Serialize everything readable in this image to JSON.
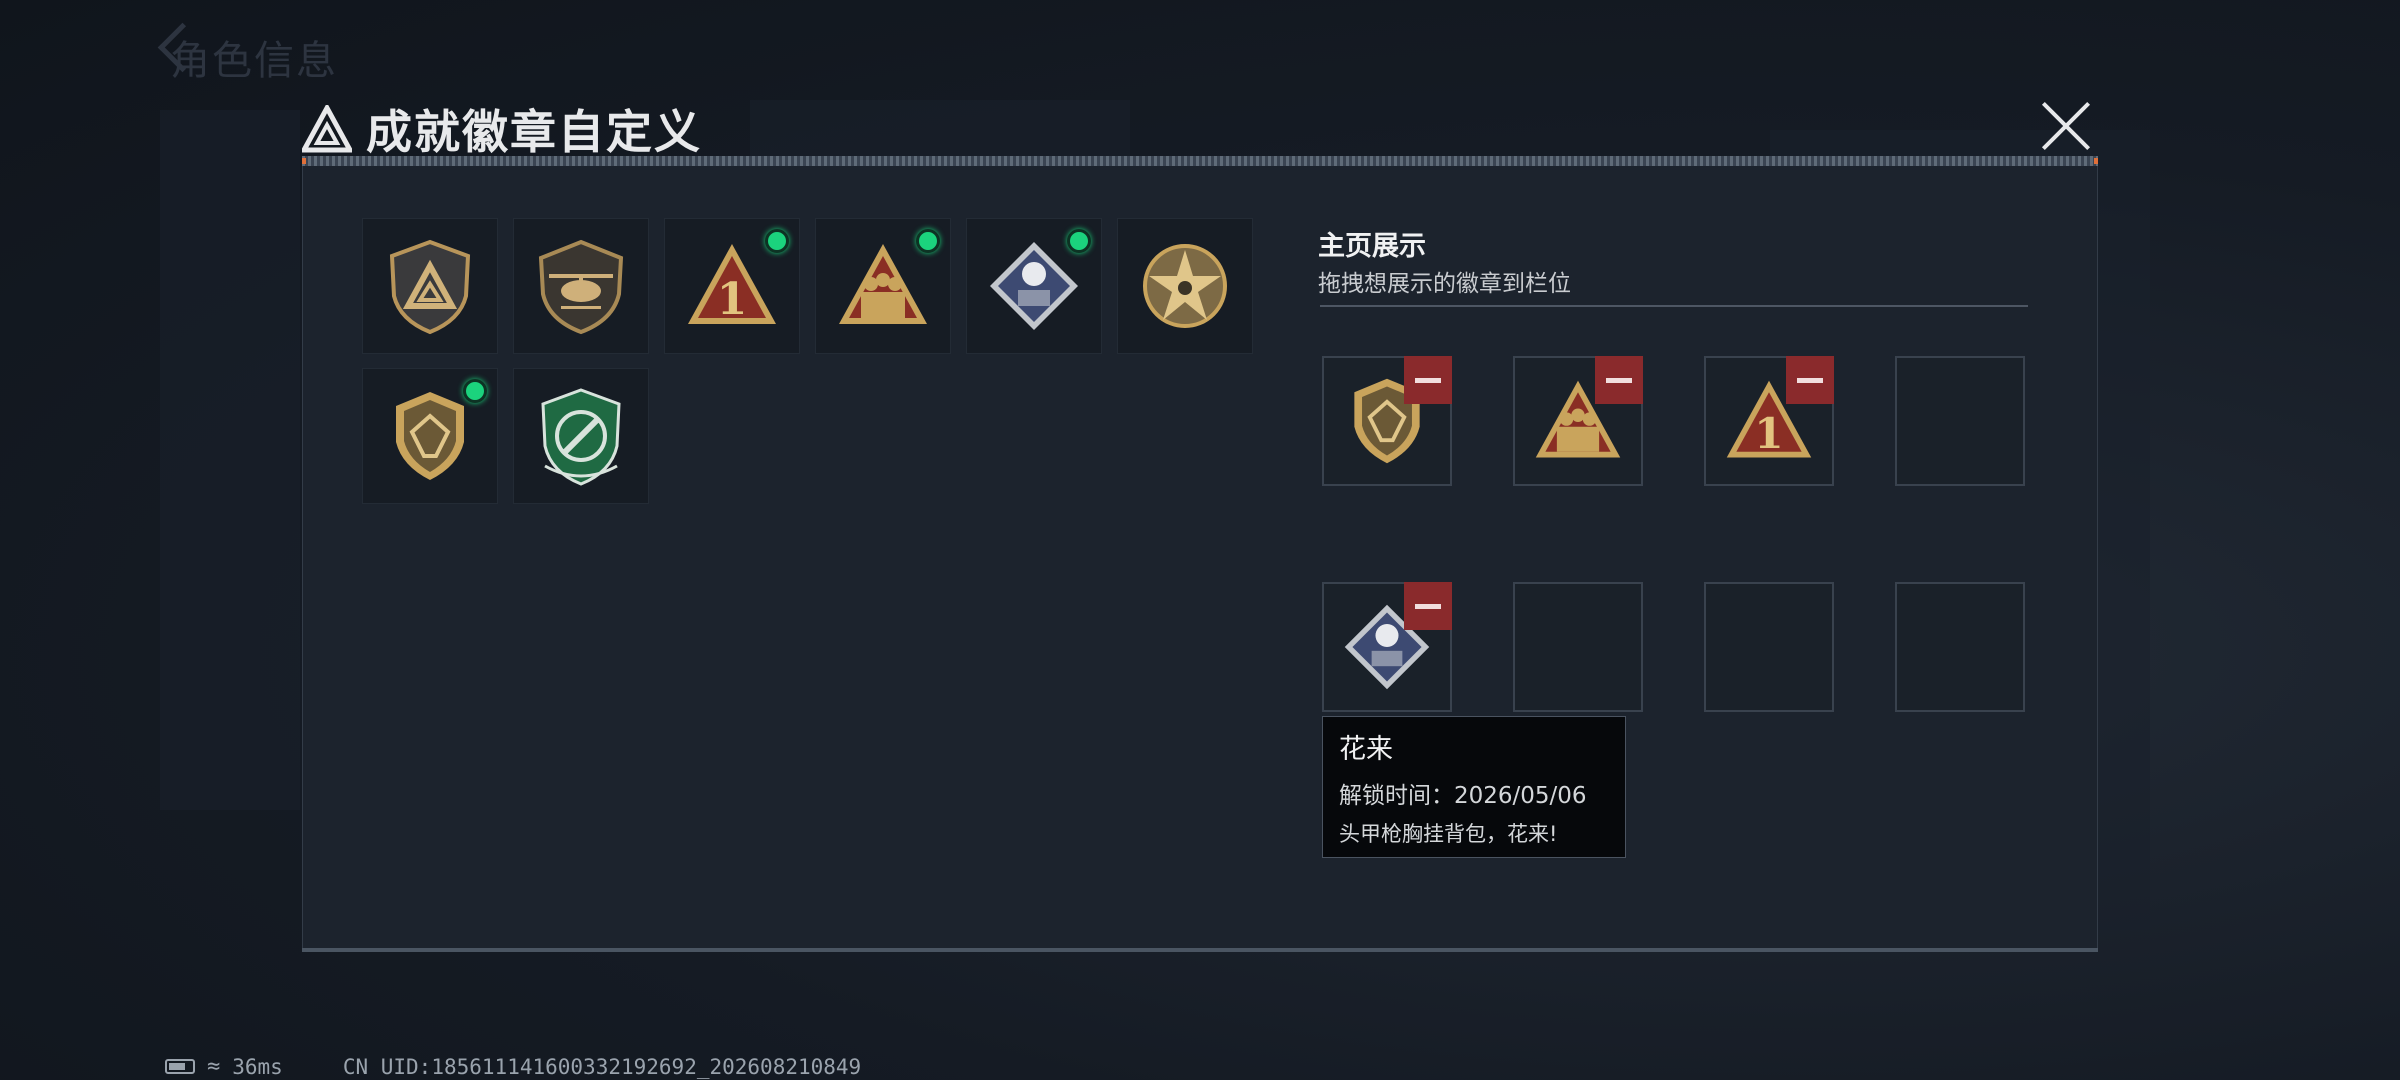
{
  "background": {
    "page_title": "角色信息"
  },
  "dialog": {
    "title": "成就徽章自定义",
    "close_icon": "close-icon"
  },
  "badges": [
    {
      "icon": "delta-shield-badge",
      "new": false
    },
    {
      "icon": "helicopter-shield-badge",
      "new": false
    },
    {
      "icon": "number-one-triangle-badge",
      "new": true
    },
    {
      "icon": "squad-triangle-badge",
      "new": true
    },
    {
      "icon": "flower-diamond-badge",
      "new": true
    },
    {
      "icon": "star-medallion-badge",
      "new": false
    },
    {
      "icon": "gem-shield-badge",
      "new": true
    },
    {
      "icon": "green-crest-badge",
      "new": false
    }
  ],
  "home": {
    "title": "主页展示",
    "subtitle": "拖拽想展示的徽章到栏位",
    "slots": [
      {
        "badge": "gem-shield-badge"
      },
      {
        "badge": "squad-triangle-badge"
      },
      {
        "badge": "number-one-triangle-badge"
      },
      {
        "badge": ""
      },
      {
        "badge": "flower-diamond-badge"
      },
      {
        "badge": ""
      },
      {
        "badge": ""
      },
      {
        "badge": ""
      }
    ]
  },
  "tooltip": {
    "name": "花来",
    "unlock": "解锁时间：2026/05/06",
    "description": "头甲枪胸挂背包，花来!"
  },
  "status": {
    "ping": "36ms",
    "uid": "CN UID:1856111416003321926​92_202608210849"
  },
  "colors": {
    "new_indicator": "#1bd37d",
    "remove_button": "#8a2a2c",
    "badge_gold": "#c9a45c"
  }
}
